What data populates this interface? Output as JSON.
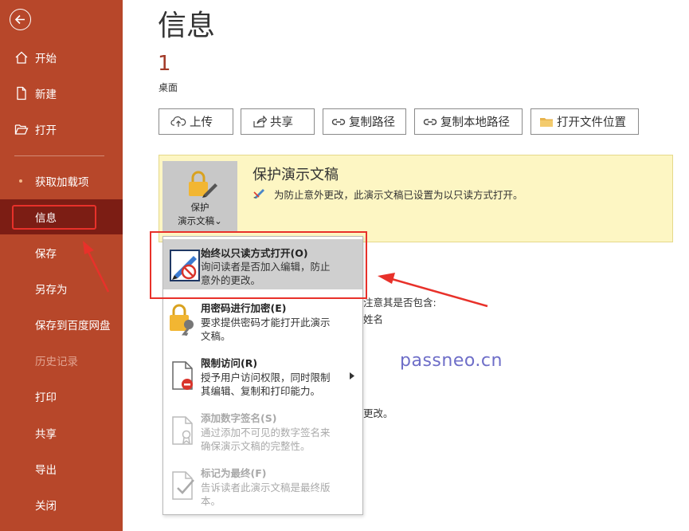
{
  "sidebar": {
    "items": [
      {
        "label": "开始",
        "icon": "home-icon"
      },
      {
        "label": "新建",
        "icon": "new-file-icon"
      },
      {
        "label": "打开",
        "icon": "open-folder-icon"
      },
      {
        "label": "获取加载项",
        "icon": "dot-icon"
      },
      {
        "label": "信息",
        "active": true
      },
      {
        "label": "保存"
      },
      {
        "label": "另存为"
      },
      {
        "label": "保存到百度网盘"
      },
      {
        "label": "历史记录",
        "disabled": true
      },
      {
        "label": "打印"
      },
      {
        "label": "共享"
      },
      {
        "label": "导出"
      },
      {
        "label": "关闭"
      }
    ]
  },
  "main": {
    "title": "信息",
    "file_name": "1",
    "file_location": "桌面",
    "toolbar": {
      "upload": "上传",
      "share": "共享",
      "copy_path": "复制路径",
      "copy_local_path": "复制本地路径",
      "open_location": "打开文件位置"
    },
    "protect": {
      "tile_line1": "保护",
      "tile_line2": "演示文稿",
      "tile_chevron": "⌄",
      "heading": "保护演示文稿",
      "description": "为防止意外更改，此演示文稿已设置为以只读方式打开。"
    },
    "background_fragments": {
      "line1": "注意其是否包含:",
      "line2": "姓名",
      "line3": "更改。"
    }
  },
  "menu": {
    "items": [
      {
        "title": "始终以只读方式打开(O)",
        "desc_line1": "询问读者是否加入编辑，防止",
        "desc_line2": "意外的更改。"
      },
      {
        "title": "用密码进行加密(E)",
        "desc_line1": "要求提供密码才能打开此演示",
        "desc_line2": "文稿。"
      },
      {
        "title": "限制访问(R)",
        "desc_line1": "授予用户访问权限，同时限制",
        "desc_line2": "其编辑、复制和打印能力。"
      },
      {
        "title": "添加数字签名(S)",
        "desc_line1": "通过添加不可见的数字签名来",
        "desc_line2": "确保演示文稿的完整性。"
      },
      {
        "title": "标记为最终(F)",
        "desc_line1": "告诉读者此演示文稿是最终版",
        "desc_line2": "本。"
      }
    ]
  },
  "watermark": "passneo.cn",
  "colors": {
    "sidebar": "#b7472a",
    "sidebar_active": "#7c1d14",
    "protect_bg": "#fdf6c3",
    "annotation_red": "#e8312a"
  }
}
